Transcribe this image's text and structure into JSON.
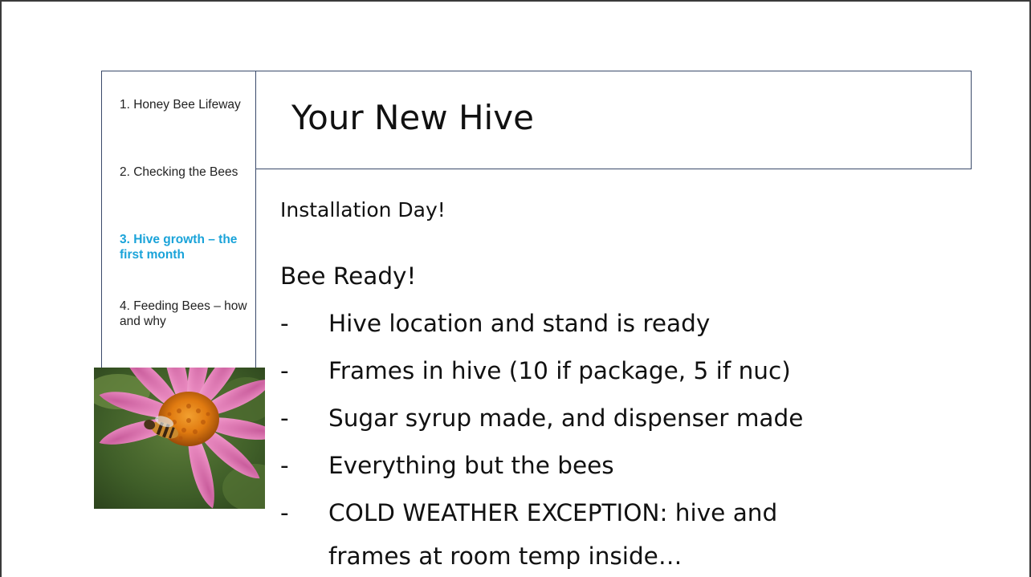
{
  "sidebar": {
    "items": [
      {
        "label": "1. Honey Bee Lifeway",
        "active": false
      },
      {
        "label": "2. Checking the Bees",
        "active": false
      },
      {
        "label": "3. Hive growth – the first month",
        "active": true
      },
      {
        "label": "4. Feeding Bees – how and why",
        "active": false
      }
    ]
  },
  "title": "Your New Hive",
  "subhead_1": "Installation Day!",
  "subhead_2": "Bee Ready!",
  "bullets": {
    "dash": "-",
    "items": [
      "Hive location and stand is ready",
      "Frames in hive (10 if package, 5 if nuc)",
      "Sugar syrup made, and dispenser made",
      "Everything but the bees",
      "COLD WEATHER EXCEPTION: hive and",
      "frames at room temp inside…"
    ]
  },
  "colors": {
    "active_link": "#1aa3d9",
    "border": "#3a4a6a",
    "flower_petal": "#e98ac0",
    "flower_center": "#e07a10"
  },
  "photo": {
    "icon": "coneflower-with-bee-photo"
  }
}
